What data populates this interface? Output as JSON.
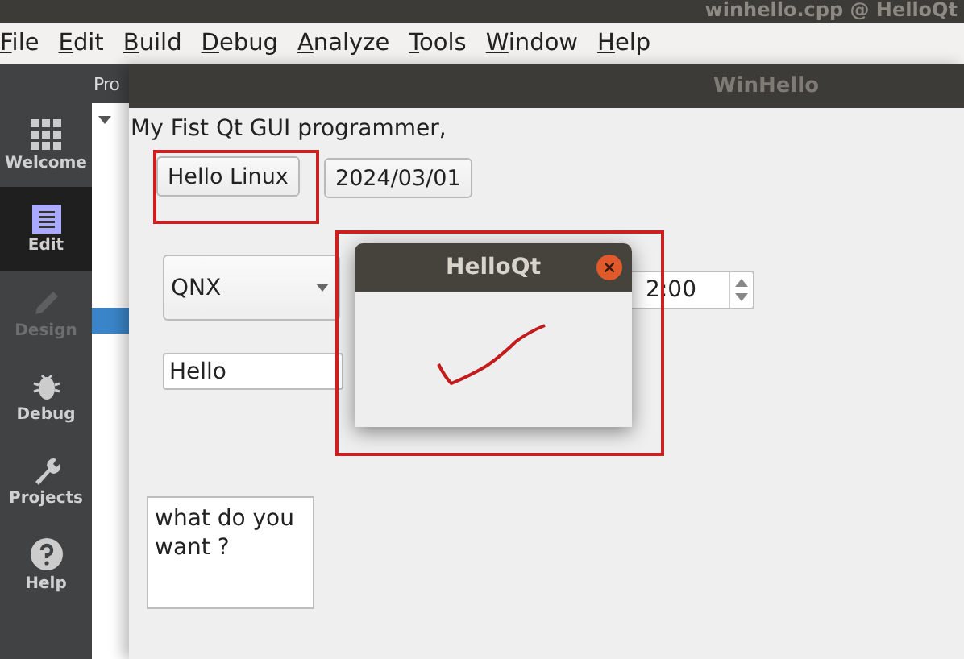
{
  "ide": {
    "title": "winhello.cpp @ HelloQt",
    "menu": [
      "File",
      "Edit",
      "Build",
      "Debug",
      "Analyze",
      "Tools",
      "Window",
      "Help"
    ],
    "sidebar": [
      {
        "label": "Welcome",
        "selected": false,
        "disabled": false
      },
      {
        "label": "Edit",
        "selected": true,
        "disabled": false
      },
      {
        "label": "Design",
        "selected": false,
        "disabled": true
      },
      {
        "label": "Debug",
        "selected": false,
        "disabled": false
      },
      {
        "label": "Projects",
        "selected": false,
        "disabled": false
      },
      {
        "label": "Help",
        "selected": false,
        "disabled": false
      }
    ],
    "projects_panel": {
      "header": "Pro"
    }
  },
  "win_hello": {
    "title": "WinHello",
    "label": "My Fist Qt GUI programmer,",
    "hello_button": "Hello Linux",
    "date_button": "2024/03/01",
    "combo": {
      "value": "QNX"
    },
    "time_spin": {
      "value": "2:00"
    },
    "line_edit": {
      "value": "Hello"
    },
    "text_edit": {
      "value": "what do you want ?"
    }
  },
  "hello_qt_dialog": {
    "title": "HelloQt"
  }
}
